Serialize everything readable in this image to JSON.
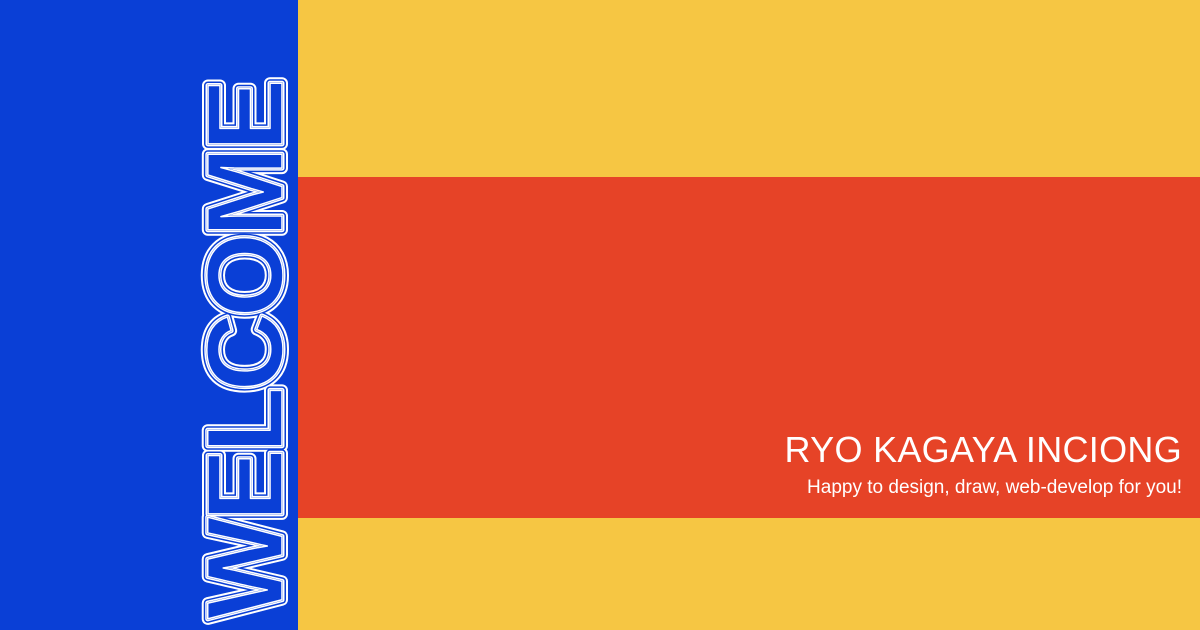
{
  "colors": {
    "blue": "#0a3fd6",
    "yellow": "#f6c643",
    "red": "#e64327",
    "white": "#ffffff"
  },
  "welcome": {
    "word": "WELCOME"
  },
  "hero": {
    "name": "RYO KAGAYA INCIONG",
    "tagline": "Happy to design, draw, web-develop for you!"
  }
}
